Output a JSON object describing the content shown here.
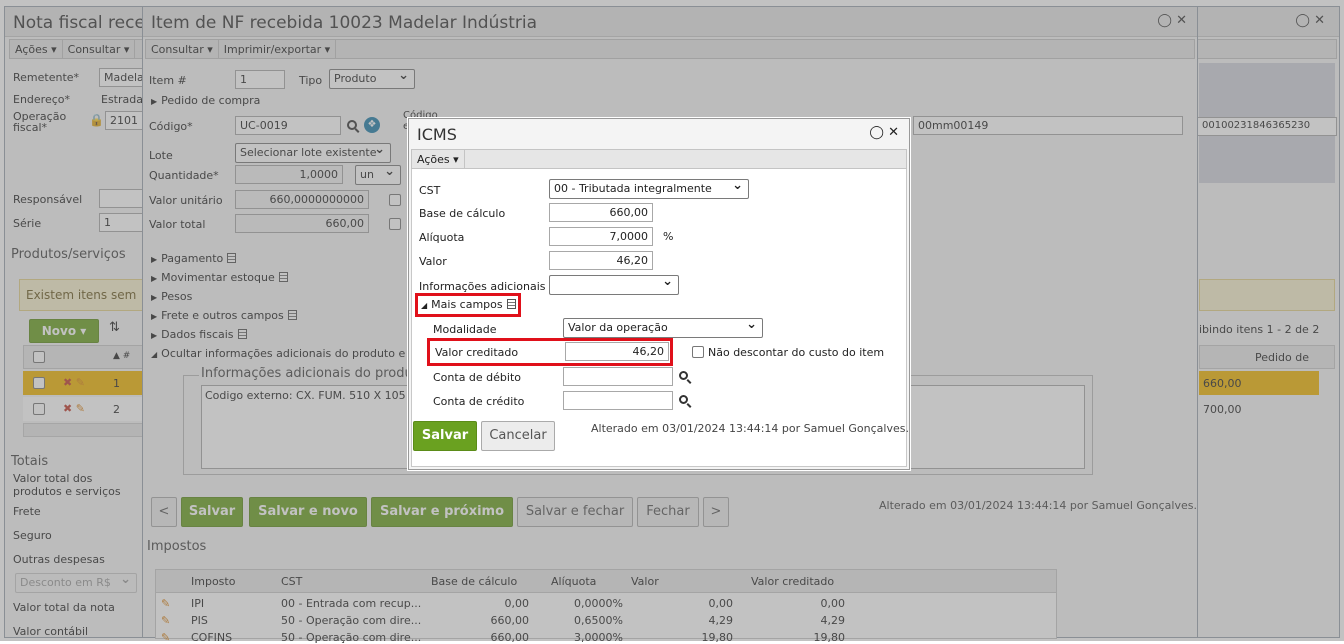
{
  "bg": {
    "nota_title": "Nota fiscal recel",
    "acoes": "Ações",
    "consultar": "Consultar",
    "remetente_label": "Remetente*",
    "remetente_value": "Madela",
    "endereco_label": "Endereço*",
    "endereco_value": "Estrada",
    "operacao_label": "Operação fiscal*",
    "operacao_value": "2101",
    "responsavel_label": "Responsável",
    "serie_label": "Série",
    "serie_value": "1",
    "produtos_label": "Produtos/serviços",
    "existem": "Existem itens sem",
    "novo": "Novo",
    "row1_num": "1",
    "row2_num": "2",
    "totais": "Totais",
    "valor_total_prod": "Valor total dos produtos e serviços",
    "frete": "Frete",
    "seguro": "Seguro",
    "outras": "Outras despesas",
    "desconto": "Desconto em R$",
    "valor_total_nota": "Valor total da nota",
    "valor_contabil": "Valor contábil",
    "right_value": "00100231846365230",
    "right_pager": "ibindo itens 1 - 2 de 2",
    "right_col": "Pedido de",
    "right_row1": "660,00",
    "right_row2": "700,00"
  },
  "item": {
    "title": "Item de NF recebida 10023 Madelar Indústria",
    "consultar": "Consultar",
    "imprimir": "Imprimir/exportar",
    "item_label": "Item #",
    "item_value": "1",
    "tipo_label": "Tipo",
    "tipo_value": "Produto",
    "pedido_compra": "Pedido de compra",
    "codigo_label": "Código*",
    "codigo_value": "UC-0019",
    "codigo2_label": "Código",
    "codigo2_sub": "e",
    "right_field": "00mm00149",
    "lote_label": "Lote",
    "lote_value": "Selecionar lote existente",
    "qtd_label": "Quantidade*",
    "qtd_value": "1,0000",
    "qtd_unit": "un",
    "vu_label": "Valor unitário",
    "vu_value": "660,0000000000",
    "vt_label": "Valor total",
    "vt_value": "660,00",
    "pagamento": "Pagamento",
    "movimentar": "Movimentar estoque",
    "pesos": "Pesos",
    "frete": "Frete e outros campos",
    "dados_fiscais": "Dados fiscais",
    "ocultar": "Ocultar informações adicionais do produto e c",
    "info_legend": "Informações adicionais do produ",
    "info_text": "Codigo externo: CX. FUM. 510 X 105",
    "btn_prev": "<",
    "btn_salvar": "Salvar",
    "btn_salvar_novo": "Salvar e novo",
    "btn_salvar_proximo": "Salvar e próximo",
    "btn_salvar_fechar": "Salvar e fechar",
    "btn_fechar": "Fechar",
    "btn_next": ">",
    "alterado": "Alterado em 03/01/2024 13:44:14 por Samuel Gonçalves.",
    "impostos": "Impostos",
    "tax_headers": [
      "Imposto",
      "CST",
      "Base de cálculo",
      "Alíquota",
      "Valor",
      "Valor creditado"
    ],
    "tax_rows": [
      [
        "IPI",
        "00 - Entrada com recup...",
        "0,00",
        "0,0000%",
        "0,00",
        "0,00"
      ],
      [
        "PIS",
        "50 - Operação com dire...",
        "660,00",
        "0,6500%",
        "4,29",
        "4,29"
      ],
      [
        "COFINS",
        "50 - Operação com dire...",
        "660,00",
        "3,0000%",
        "19,80",
        "19,80"
      ]
    ]
  },
  "icms": {
    "title": "ICMS",
    "acoes": "Ações",
    "cst_label": "CST",
    "cst_value": "00 - Tributada integralmente",
    "base_label": "Base de cálculo",
    "base_value": "660,00",
    "aliq_label": "Alíquota",
    "aliq_value": "7,0000",
    "aliq_unit": "%",
    "valor_label": "Valor",
    "valor_value": "46,20",
    "info_label": "Informações adicionais",
    "info_value": "",
    "mais_campos": "Mais campos",
    "modalidade_label": "Modalidade",
    "modalidade_value": "Valor da operação",
    "vc_label": "Valor creditado",
    "vc_value": "46,20",
    "nao_descontar": "Não descontar do custo do item",
    "debito_label": "Conta de débito",
    "credito_label": "Conta de crédito",
    "salvar": "Salvar",
    "cancelar": "Cancelar",
    "alterado": "Alterado em 03/01/2024 13:44:14 por Samuel Gonçalves."
  },
  "colors": {
    "accent_green": "#6aa120",
    "highlight_red": "#e0101a",
    "row_selected": "#f0b400"
  }
}
